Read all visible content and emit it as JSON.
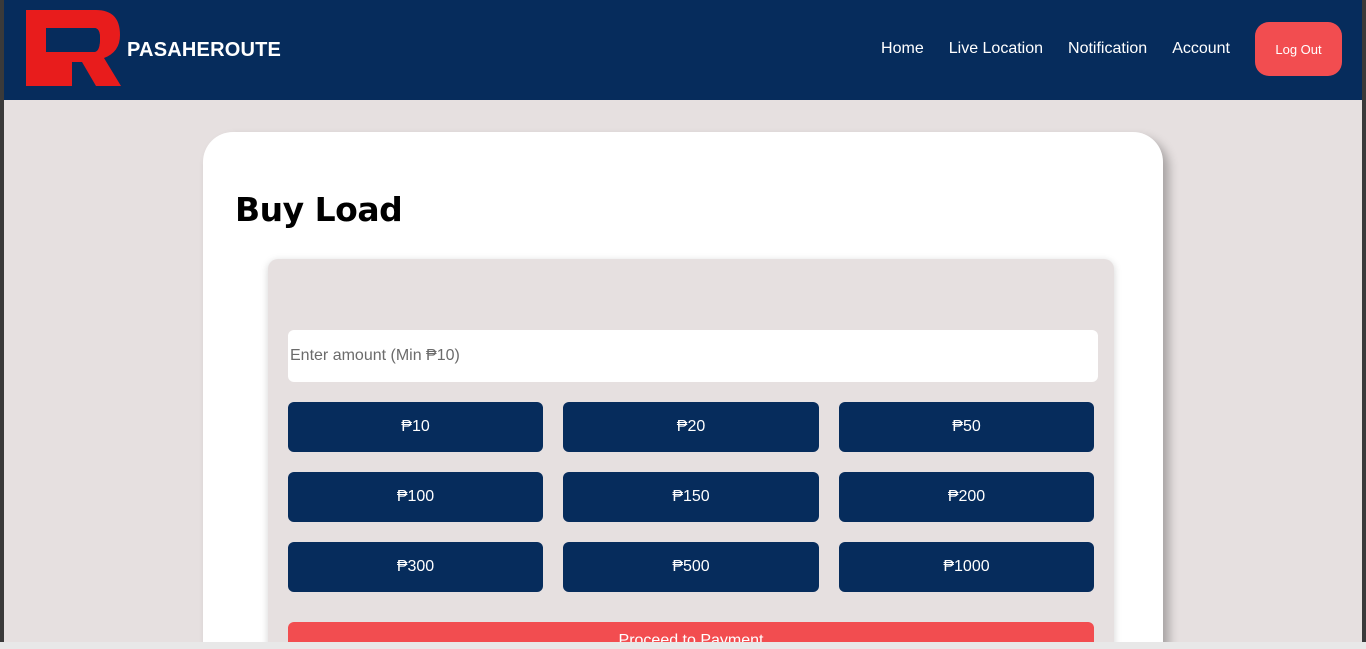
{
  "colors": {
    "navbar": "#062c5c",
    "accent": "#f24d50",
    "page_bg": "#e6e0e0",
    "button": "#062c5c"
  },
  "header": {
    "logo_icon": "pasaheroute-logo-icon",
    "brand": "PASAHEROUTE",
    "nav": {
      "home": "Home",
      "live_location": "Live Location",
      "notification": "Notification",
      "account": "Account"
    },
    "logout": "Log Out"
  },
  "main": {
    "title": "Buy Load",
    "amount_placeholder": "Enter amount (Min ₱10)",
    "amounts": [
      "₱10",
      "₱20",
      "₱50",
      "₱100",
      "₱150",
      "₱200",
      "₱300",
      "₱500",
      "₱1000"
    ],
    "proceed": "Proceed to Payment"
  }
}
